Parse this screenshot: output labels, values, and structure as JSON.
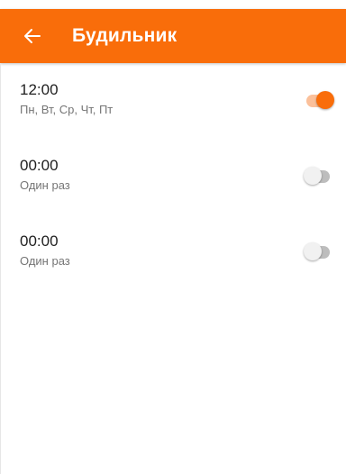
{
  "header": {
    "title": "Будильник",
    "back_icon": "arrow-left-icon",
    "color": "#f96d0a"
  },
  "alarms": [
    {
      "time": "12:00",
      "days": "Пн, Вт, Ср, Чт, Пт",
      "enabled": true
    },
    {
      "time": "00:00",
      "days": "Один раз",
      "enabled": false
    },
    {
      "time": "00:00",
      "days": "Один раз",
      "enabled": false
    }
  ],
  "colors": {
    "accent": "#f96d0a",
    "switch_on_track": "#fbc09a",
    "switch_off_track": "#bdbdbd",
    "switch_off_thumb": "#f1f1f1"
  }
}
